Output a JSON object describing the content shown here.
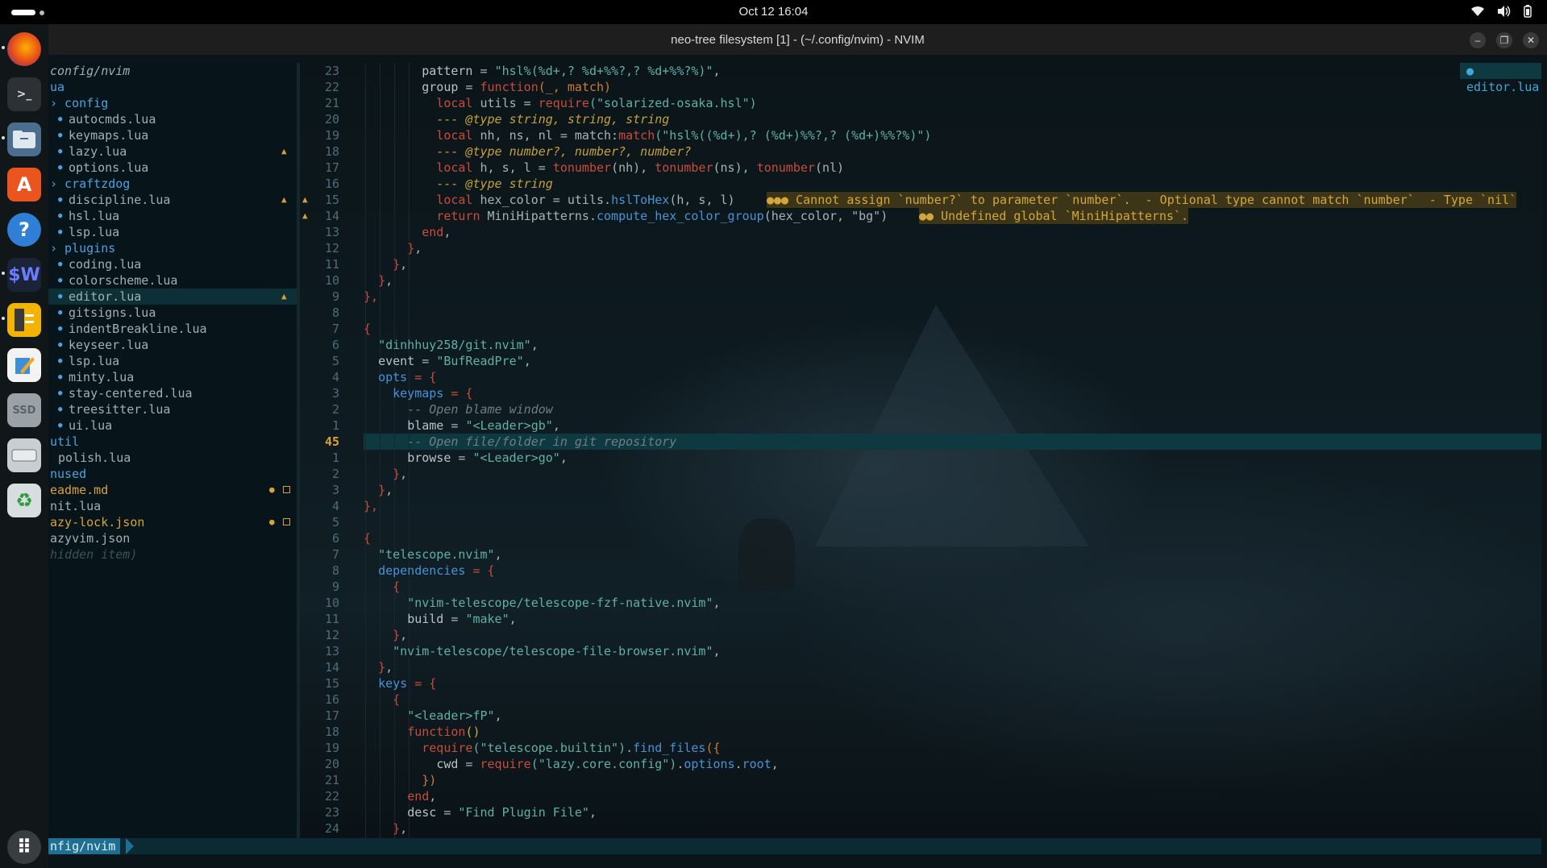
{
  "topbar": {
    "clock": "Oct 12  16:04"
  },
  "window": {
    "title": "neo-tree filesystem [1] - (~/.config/nvim) - NVIM"
  },
  "tree": {
    "rows": [
      {
        "text": "config/nvim",
        "indent": 0,
        "color": "#9fb0b6",
        "italic": true
      },
      {
        "text": "ua",
        "indent": 0,
        "color": "#4aa3e0"
      },
      {
        "text": "› config",
        "indent": 0,
        "color": "#4aa3e0"
      },
      {
        "text": "autocmds.lua",
        "indent": 1,
        "color": "#9fb0b6",
        "file": true
      },
      {
        "text": "keymaps.lua",
        "indent": 1,
        "color": "#9fb0b6",
        "file": true
      },
      {
        "text": "lazy.lua",
        "indent": 1,
        "color": "#9fb0b6",
        "file": true,
        "warn": true
      },
      {
        "text": "options.lua",
        "indent": 1,
        "color": "#9fb0b6",
        "file": true
      },
      {
        "text": "› craftzdog",
        "indent": 0,
        "color": "#4aa3e0"
      },
      {
        "text": "discipline.lua",
        "indent": 1,
        "color": "#9fb0b6",
        "file": true,
        "warn": true
      },
      {
        "text": "hsl.lua",
        "indent": 1,
        "color": "#9fb0b6",
        "file": true
      },
      {
        "text": "lsp.lua",
        "indent": 1,
        "color": "#9fb0b6",
        "file": true
      },
      {
        "text": "› plugins",
        "indent": 0,
        "color": "#4aa3e0"
      },
      {
        "text": "coding.lua",
        "indent": 1,
        "color": "#9fb0b6",
        "file": true
      },
      {
        "text": "colorscheme.lua",
        "indent": 1,
        "color": "#9fb0b6",
        "file": true
      },
      {
        "text": "editor.lua",
        "indent": 1,
        "color": "#9fb0b6",
        "file": true,
        "warn": true,
        "selected": true
      },
      {
        "text": "gitsigns.lua",
        "indent": 1,
        "color": "#9fb0b6",
        "file": true
      },
      {
        "text": "indentBreakline.lua",
        "indent": 1,
        "color": "#9fb0b6",
        "file": true
      },
      {
        "text": "keyseer.lua",
        "indent": 1,
        "color": "#9fb0b6",
        "file": true
      },
      {
        "text": "lsp.lua",
        "indent": 1,
        "color": "#9fb0b6",
        "file": true
      },
      {
        "text": "minty.lua",
        "indent": 1,
        "color": "#9fb0b6",
        "file": true
      },
      {
        "text": "stay-centered.lua",
        "indent": 1,
        "color": "#9fb0b6",
        "file": true
      },
      {
        "text": "treesitter.lua",
        "indent": 1,
        "color": "#9fb0b6",
        "file": true
      },
      {
        "text": "ui.lua",
        "indent": 1,
        "color": "#9fb0b6",
        "file": true
      },
      {
        "text": "util",
        "indent": 0,
        "color": "#4aa3e0"
      },
      {
        "text": "polish.lua",
        "indent": 1,
        "color": "#9fb0b6"
      },
      {
        "text": "nused",
        "indent": 0,
        "color": "#4aa3e0"
      },
      {
        "text": "eadme.md",
        "indent": 0,
        "color": "#d8a23a",
        "modified": true
      },
      {
        "text": "nit.lua",
        "indent": 0,
        "color": "#9fb0b6"
      },
      {
        "text": "azy-lock.json",
        "indent": 0,
        "color": "#d8a23a",
        "modified": true
      },
      {
        "text": "azyvim.json",
        "indent": 0,
        "color": "#9fb0b6"
      },
      {
        "text": "hidden item)",
        "indent": 0,
        "color": "#3b525c",
        "italic": true
      }
    ]
  },
  "editor": {
    "float_tab": "editor.lua",
    "line_numbers": [
      "23",
      "22",
      "21",
      "20",
      "19",
      "18",
      "17",
      "16",
      "15",
      "14",
      "13",
      "12",
      "11",
      "10",
      "9",
      "8",
      "7",
      "6",
      "5",
      "4",
      "3",
      "2",
      "1",
      "45",
      "1",
      "2",
      "3",
      "4",
      "5",
      "6",
      "7",
      "8",
      "9",
      "10",
      "11",
      "12",
      "13",
      "14",
      "15",
      "16",
      "17",
      "18",
      "19",
      "20",
      "21",
      "22",
      "23",
      "24"
    ],
    "current_line_index": 23,
    "sign_rows": [
      8,
      9
    ],
    "lines": [
      [
        [
          "        ",
          "n"
        ],
        [
          "pattern",
          "v"
        ],
        [
          " = ",
          "n"
        ],
        [
          "\"hsl%(%d+,? %d+%%?,? %d+%%?%)\"",
          "s"
        ],
        [
          ",",
          "n"
        ]
      ],
      [
        [
          "        ",
          "n"
        ],
        [
          "group",
          "v"
        ],
        [
          " = ",
          "n"
        ],
        [
          "function",
          "k"
        ],
        [
          "(_, match)",
          "o"
        ]
      ],
      [
        [
          "          ",
          "n"
        ],
        [
          "local",
          "k"
        ],
        [
          " utils = ",
          "n"
        ],
        [
          "require",
          "k"
        ],
        [
          "(\"solarized-osaka.hsl\")",
          "s"
        ]
      ],
      [
        [
          "          ",
          "n"
        ],
        [
          "--- @type string, string, string",
          "t"
        ]
      ],
      [
        [
          "          ",
          "n"
        ],
        [
          "local",
          "k"
        ],
        [
          " nh, ns, nl = match:",
          "n"
        ],
        [
          "match",
          "k"
        ],
        [
          "(\"hsl%((%d+),? (%d+)%%?,? (%d+)%%?%)\")",
          "s"
        ]
      ],
      [
        [
          "          ",
          "n"
        ],
        [
          "--- @type number?, number?, number?",
          "t"
        ]
      ],
      [
        [
          "          ",
          "n"
        ],
        [
          "local",
          "k"
        ],
        [
          " h, s, l = ",
          "n"
        ],
        [
          "tonumber",
          "k"
        ],
        [
          "(nh), ",
          "n"
        ],
        [
          "tonumber",
          "k"
        ],
        [
          "(ns), ",
          "n"
        ],
        [
          "tonumber",
          "k"
        ],
        [
          "(nl)",
          "n"
        ]
      ],
      [
        [
          "          ",
          "n"
        ],
        [
          "--- @type string",
          "t"
        ]
      ],
      [
        [
          "          ",
          "n"
        ],
        [
          "local",
          "k"
        ],
        [
          " hex_color = utils.",
          "n"
        ],
        [
          "hslToHex",
          "f"
        ],
        [
          "(h, s, l)",
          "n"
        ]
      ],
      [
        [
          "          ",
          "n"
        ],
        [
          "return",
          "k"
        ],
        [
          " MiniHipatterns.",
          "n"
        ],
        [
          "compute_hex_color_group",
          "f"
        ],
        [
          "(hex_color, \"bg\")",
          "n"
        ]
      ],
      [
        [
          "        ",
          "n"
        ],
        [
          "end",
          "k"
        ],
        [
          ",",
          "n"
        ]
      ],
      [
        [
          "      ",
          "n"
        ],
        [
          "}",
          "k"
        ],
        [
          ",",
          "n"
        ]
      ],
      [
        [
          "    ",
          "n"
        ],
        [
          "}",
          "k"
        ],
        [
          ",",
          "n"
        ]
      ],
      [
        [
          "  ",
          "n"
        ],
        [
          "}",
          "k"
        ],
        [
          ",",
          "n"
        ]
      ],
      [
        [
          "},",
          "k"
        ]
      ],
      [
        [
          "",
          "n"
        ]
      ],
      [
        [
          "{",
          "k"
        ]
      ],
      [
        [
          "  ",
          "n"
        ],
        [
          "\"dinhhuy258/git.nvim\"",
          "s"
        ],
        [
          ",",
          "n"
        ]
      ],
      [
        [
          "  ",
          "n"
        ],
        [
          "event",
          "v"
        ],
        [
          " = ",
          "n"
        ],
        [
          "\"BufReadPre\"",
          "s"
        ],
        [
          ",",
          "n"
        ]
      ],
      [
        [
          "  ",
          "n"
        ],
        [
          "opts",
          "f"
        ],
        [
          " = {",
          "k"
        ]
      ],
      [
        [
          "    ",
          "n"
        ],
        [
          "keymaps",
          "f"
        ],
        [
          " = {",
          "k"
        ]
      ],
      [
        [
          "      ",
          "n"
        ],
        [
          "-- Open blame window",
          "c"
        ]
      ],
      [
        [
          "      ",
          "n"
        ],
        [
          "blame",
          "v"
        ],
        [
          " = ",
          "n"
        ],
        [
          "\"<Leader>gb\"",
          "s"
        ],
        [
          ",",
          "n"
        ]
      ],
      [
        [
          "      ",
          "n"
        ],
        [
          "-- Open file/folder in git repository",
          "c"
        ]
      ],
      [
        [
          "      ",
          "n"
        ],
        [
          "browse",
          "v"
        ],
        [
          " = ",
          "n"
        ],
        [
          "\"<Leader>go\"",
          "s"
        ],
        [
          ",",
          "n"
        ]
      ],
      [
        [
          "    ",
          "n"
        ],
        [
          "}",
          "k"
        ],
        [
          ",",
          "n"
        ]
      ],
      [
        [
          "  ",
          "n"
        ],
        [
          "}",
          "k"
        ],
        [
          ",",
          "n"
        ]
      ],
      [
        [
          "},",
          "k"
        ]
      ],
      [
        [
          "",
          "n"
        ]
      ],
      [
        [
          "{",
          "k"
        ]
      ],
      [
        [
          "  ",
          "n"
        ],
        [
          "\"telescope.nvim\"",
          "s"
        ],
        [
          ",",
          "n"
        ]
      ],
      [
        [
          "  ",
          "n"
        ],
        [
          "dependencies",
          "f"
        ],
        [
          " = {",
          "k"
        ]
      ],
      [
        [
          "    ",
          "n"
        ],
        [
          "{",
          "k"
        ]
      ],
      [
        [
          "      ",
          "n"
        ],
        [
          "\"nvim-telescope/telescope-fzf-native.nvim\"",
          "s"
        ],
        [
          ",",
          "n"
        ]
      ],
      [
        [
          "      ",
          "n"
        ],
        [
          "build",
          "v"
        ],
        [
          " = ",
          "n"
        ],
        [
          "\"make\"",
          "s"
        ],
        [
          ",",
          "n"
        ]
      ],
      [
        [
          "    ",
          "n"
        ],
        [
          "}",
          "k"
        ],
        [
          ",",
          "n"
        ]
      ],
      [
        [
          "    ",
          "n"
        ],
        [
          "\"nvim-telescope/telescope-file-browser.nvim\"",
          "s"
        ],
        [
          ",",
          "n"
        ]
      ],
      [
        [
          "  ",
          "n"
        ],
        [
          "}",
          "k"
        ],
        [
          ",",
          "n"
        ]
      ],
      [
        [
          "  ",
          "n"
        ],
        [
          "keys",
          "f"
        ],
        [
          " = {",
          "k"
        ]
      ],
      [
        [
          "    ",
          "n"
        ],
        [
          "{",
          "k"
        ]
      ],
      [
        [
          "      ",
          "n"
        ],
        [
          "\"<leader>fP\"",
          "s"
        ],
        [
          ",",
          "n"
        ]
      ],
      [
        [
          "      ",
          "n"
        ],
        [
          "function",
          "k"
        ],
        [
          "()",
          "p"
        ]
      ],
      [
        [
          "        ",
          "n"
        ],
        [
          "require",
          "k"
        ],
        [
          "(\"telescope.builtin\")",
          "s"
        ],
        [
          ".",
          "n"
        ],
        [
          "find_files",
          "f"
        ],
        [
          "({",
          "o"
        ]
      ],
      [
        [
          "          ",
          "n"
        ],
        [
          "cwd",
          "v"
        ],
        [
          " = ",
          "n"
        ],
        [
          "require",
          "k"
        ],
        [
          "(\"lazy.core.config\")",
          "s"
        ],
        [
          ".",
          "n"
        ],
        [
          "options",
          "f"
        ],
        [
          ".",
          "n"
        ],
        [
          "root",
          "f"
        ],
        [
          ",",
          "n"
        ]
      ],
      [
        [
          "        ",
          "n"
        ],
        [
          "})",
          "o"
        ]
      ],
      [
        [
          "      ",
          "n"
        ],
        [
          "end",
          "k"
        ],
        [
          ",",
          "n"
        ]
      ],
      [
        [
          "      ",
          "n"
        ],
        [
          "desc",
          "v"
        ],
        [
          " = ",
          "n"
        ],
        [
          "\"Find Plugin File\"",
          "s"
        ],
        [
          ",",
          "n"
        ]
      ],
      [
        [
          "    ",
          "n"
        ],
        [
          "}",
          "k"
        ],
        [
          ",",
          "n"
        ]
      ]
    ],
    "diagnostics": [
      {
        "row": 8,
        "text": "●●● Cannot assign `number?` to parameter `number`.  - Optional type cannot match `number`  - Type `nil`",
        "cls": "w1"
      },
      {
        "row": 9,
        "text": "●● Undefined global `MiniHipatterns`.",
        "cls": "w2"
      }
    ]
  },
  "status": {
    "mode": "nfig/nvim"
  },
  "colors": {
    "accent": "#1f6f93",
    "warning": "#d4a73c",
    "string": "#5fb0a6",
    "keyword": "#cb4b3b"
  }
}
